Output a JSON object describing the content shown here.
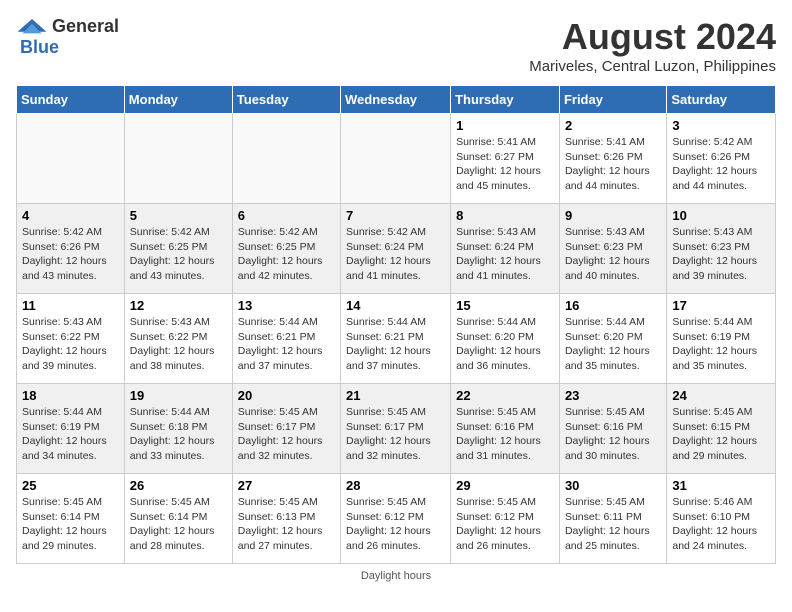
{
  "header": {
    "logo_general": "General",
    "logo_blue": "Blue",
    "title": "August 2024",
    "location": "Mariveles, Central Luzon, Philippines"
  },
  "days_of_week": [
    "Sunday",
    "Monday",
    "Tuesday",
    "Wednesday",
    "Thursday",
    "Friday",
    "Saturday"
  ],
  "weeks": [
    [
      {
        "day": "",
        "info": ""
      },
      {
        "day": "",
        "info": ""
      },
      {
        "day": "",
        "info": ""
      },
      {
        "day": "",
        "info": ""
      },
      {
        "day": "1",
        "info": "Sunrise: 5:41 AM\nSunset: 6:27 PM\nDaylight: 12 hours\nand 45 minutes."
      },
      {
        "day": "2",
        "info": "Sunrise: 5:41 AM\nSunset: 6:26 PM\nDaylight: 12 hours\nand 44 minutes."
      },
      {
        "day": "3",
        "info": "Sunrise: 5:42 AM\nSunset: 6:26 PM\nDaylight: 12 hours\nand 44 minutes."
      }
    ],
    [
      {
        "day": "4",
        "info": "Sunrise: 5:42 AM\nSunset: 6:26 PM\nDaylight: 12 hours\nand 43 minutes."
      },
      {
        "day": "5",
        "info": "Sunrise: 5:42 AM\nSunset: 6:25 PM\nDaylight: 12 hours\nand 43 minutes."
      },
      {
        "day": "6",
        "info": "Sunrise: 5:42 AM\nSunset: 6:25 PM\nDaylight: 12 hours\nand 42 minutes."
      },
      {
        "day": "7",
        "info": "Sunrise: 5:42 AM\nSunset: 6:24 PM\nDaylight: 12 hours\nand 41 minutes."
      },
      {
        "day": "8",
        "info": "Sunrise: 5:43 AM\nSunset: 6:24 PM\nDaylight: 12 hours\nand 41 minutes."
      },
      {
        "day": "9",
        "info": "Sunrise: 5:43 AM\nSunset: 6:23 PM\nDaylight: 12 hours\nand 40 minutes."
      },
      {
        "day": "10",
        "info": "Sunrise: 5:43 AM\nSunset: 6:23 PM\nDaylight: 12 hours\nand 39 minutes."
      }
    ],
    [
      {
        "day": "11",
        "info": "Sunrise: 5:43 AM\nSunset: 6:22 PM\nDaylight: 12 hours\nand 39 minutes."
      },
      {
        "day": "12",
        "info": "Sunrise: 5:43 AM\nSunset: 6:22 PM\nDaylight: 12 hours\nand 38 minutes."
      },
      {
        "day": "13",
        "info": "Sunrise: 5:44 AM\nSunset: 6:21 PM\nDaylight: 12 hours\nand 37 minutes."
      },
      {
        "day": "14",
        "info": "Sunrise: 5:44 AM\nSunset: 6:21 PM\nDaylight: 12 hours\nand 37 minutes."
      },
      {
        "day": "15",
        "info": "Sunrise: 5:44 AM\nSunset: 6:20 PM\nDaylight: 12 hours\nand 36 minutes."
      },
      {
        "day": "16",
        "info": "Sunrise: 5:44 AM\nSunset: 6:20 PM\nDaylight: 12 hours\nand 35 minutes."
      },
      {
        "day": "17",
        "info": "Sunrise: 5:44 AM\nSunset: 6:19 PM\nDaylight: 12 hours\nand 35 minutes."
      }
    ],
    [
      {
        "day": "18",
        "info": "Sunrise: 5:44 AM\nSunset: 6:19 PM\nDaylight: 12 hours\nand 34 minutes."
      },
      {
        "day": "19",
        "info": "Sunrise: 5:44 AM\nSunset: 6:18 PM\nDaylight: 12 hours\nand 33 minutes."
      },
      {
        "day": "20",
        "info": "Sunrise: 5:45 AM\nSunset: 6:17 PM\nDaylight: 12 hours\nand 32 minutes."
      },
      {
        "day": "21",
        "info": "Sunrise: 5:45 AM\nSunset: 6:17 PM\nDaylight: 12 hours\nand 32 minutes."
      },
      {
        "day": "22",
        "info": "Sunrise: 5:45 AM\nSunset: 6:16 PM\nDaylight: 12 hours\nand 31 minutes."
      },
      {
        "day": "23",
        "info": "Sunrise: 5:45 AM\nSunset: 6:16 PM\nDaylight: 12 hours\nand 30 minutes."
      },
      {
        "day": "24",
        "info": "Sunrise: 5:45 AM\nSunset: 6:15 PM\nDaylight: 12 hours\nand 29 minutes."
      }
    ],
    [
      {
        "day": "25",
        "info": "Sunrise: 5:45 AM\nSunset: 6:14 PM\nDaylight: 12 hours\nand 29 minutes."
      },
      {
        "day": "26",
        "info": "Sunrise: 5:45 AM\nSunset: 6:14 PM\nDaylight: 12 hours\nand 28 minutes."
      },
      {
        "day": "27",
        "info": "Sunrise: 5:45 AM\nSunset: 6:13 PM\nDaylight: 12 hours\nand 27 minutes."
      },
      {
        "day": "28",
        "info": "Sunrise: 5:45 AM\nSunset: 6:12 PM\nDaylight: 12 hours\nand 26 minutes."
      },
      {
        "day": "29",
        "info": "Sunrise: 5:45 AM\nSunset: 6:12 PM\nDaylight: 12 hours\nand 26 minutes."
      },
      {
        "day": "30",
        "info": "Sunrise: 5:45 AM\nSunset: 6:11 PM\nDaylight: 12 hours\nand 25 minutes."
      },
      {
        "day": "31",
        "info": "Sunrise: 5:46 AM\nSunset: 6:10 PM\nDaylight: 12 hours\nand 24 minutes."
      }
    ]
  ],
  "footer": {
    "note": "Daylight hours"
  }
}
